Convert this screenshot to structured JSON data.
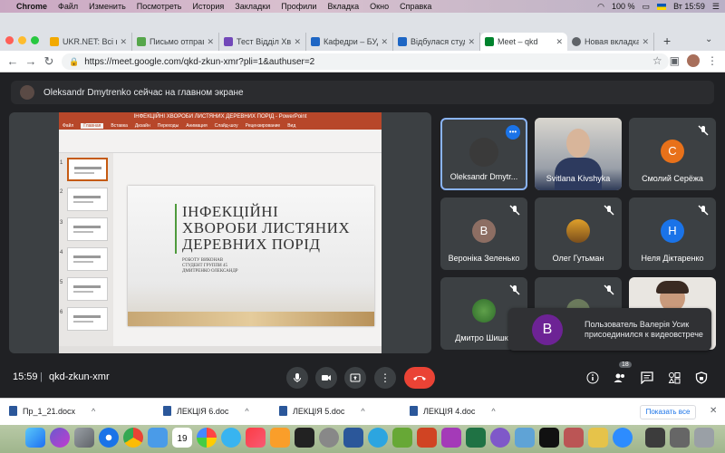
{
  "menubar": {
    "items": [
      "Chrome",
      "Файл",
      "Изменить",
      "Посмотреть",
      "История",
      "Закладки",
      "Профили",
      "Вкладка",
      "Окно",
      "Справка"
    ],
    "battery": "100 %",
    "clock": "Вт 15:59"
  },
  "tabs": [
    {
      "label": "UKR.NET: Всі но",
      "icon": "ukrnet-icon",
      "color": "#f2a900"
    },
    {
      "label": "Письмо отправ",
      "icon": "mail-icon",
      "color": "#56a64b"
    },
    {
      "label": "Тест Відділ Хв",
      "icon": "doc-icon",
      "color": "#7248b9"
    },
    {
      "label": "Кафедри – БУД",
      "icon": "bookmark-icon",
      "color": "#1e66c4"
    },
    {
      "label": "Відбулася студ",
      "icon": "bookmark-icon",
      "color": "#1e66c4"
    },
    {
      "label": "Meet – qkd",
      "icon": "meet-icon",
      "color": "#00832d"
    },
    {
      "label": "Новая вкладка",
      "icon": "chrome-icon",
      "color": "#5f6368"
    }
  ],
  "address": {
    "url": "https://meet.google.com/qkd-zkun-xmr?pli=1&authuser=2"
  },
  "banner": {
    "text": "Oleksandr Dmytrenko сейчас на главном экране"
  },
  "ppt": {
    "window_title": "ІНФЕКЦІЙНІ ХВОРОБИ ЛИСТЯНИХ ДЕРЕВНИХ ПОРІД - PowerPoint",
    "tabs": [
      "Файл",
      "Главная",
      "Вставка",
      "Дизайн",
      "Переходы",
      "Анимация",
      "Слайд-шоу",
      "Рецензирование",
      "Вид"
    ],
    "slide_title": "ІНФЕКЦІЙНІ\nХВОРОБИ ЛИСТЯНИХ\nДЕРЕВНИХ ПОРІД",
    "slide_sub": "РОБОТУ ВИКОНАВ\nСТУДЕНТ ГРУППИ 45\nДМИТРЕНКО ОЛЕКСАНДР",
    "thumb_numbers": [
      "1",
      "2",
      "3",
      "4",
      "5",
      "6"
    ]
  },
  "participants": [
    {
      "name": "Oleksandr Dmytr...",
      "type": "photo",
      "active": true,
      "speaking": true
    },
    {
      "name": "Svitlana Kivshyka",
      "type": "video"
    },
    {
      "name": "Смолий Серёжа",
      "type": "initial",
      "initial": "С",
      "color": "#e8711a"
    },
    {
      "name": "Вероніка Зеленько",
      "type": "initial",
      "initial": "В",
      "color": "#8d6e63"
    },
    {
      "name": "Олег Гутьман",
      "type": "photo"
    },
    {
      "name": "Неля Діктаренко",
      "type": "initial",
      "initial": "Н",
      "color": "#1a73e8"
    },
    {
      "name": "Дмитро Шишко",
      "type": "photo"
    },
    {
      "name": "",
      "type": "photo-partial"
    },
    {
      "name": "",
      "type": "video-partial"
    }
  ],
  "toast": {
    "initial": "В",
    "text": "Пользователь Валерія Усик присоединился к видеовстрече"
  },
  "controls": {
    "time": "15:59",
    "separator": "|",
    "meeting_code": "qkd-zkun-xmr",
    "participants_count": "18"
  },
  "downloads": {
    "items": [
      "Пр_1_21.docx",
      "ЛЕКЦІЯ 6.doc",
      "ЛЕКЦІЯ 5.doc",
      "ЛЕКЦІЯ 4.doc"
    ],
    "show_all": "Показать все"
  },
  "dock": {
    "calendar_day": "19"
  }
}
